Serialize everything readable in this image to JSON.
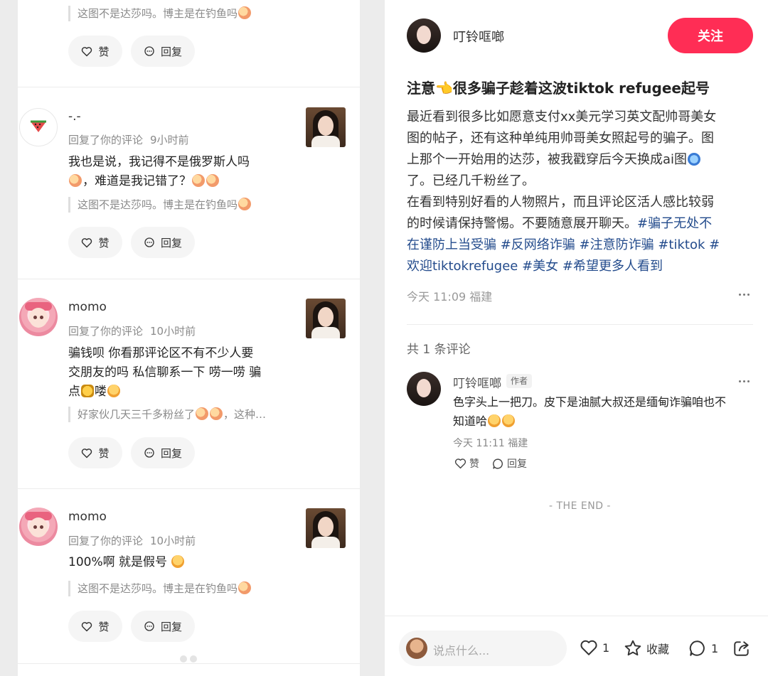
{
  "left_comments": [
    {
      "quote": "这图不是达莎吗。博主是在钓鱼吗",
      "like_label": "赞",
      "reply_label": "回复"
    },
    {
      "username": "-.-",
      "action": "回复了你的评论",
      "time": "9小时前",
      "text_line1": "我也是说，我记得不是俄罗斯人吗",
      "text_line2": "，难道是我记错了？",
      "quote": "这图不是达莎吗。博主是在钓鱼吗",
      "like_label": "赞",
      "reply_label": "回复"
    },
    {
      "username": "momo",
      "action": "回复了你的评论",
      "time": "10小时前",
      "text_line1": "骗钱呗 你看那评论区不有不少人要",
      "text_line2": "交朋友的吗 私信聊系一下 唠一唠 骗",
      "text_line3a": "点",
      "text_line3b": "喽",
      "quote": "好家伙几天三千多粉丝了",
      "quote_tail": "，这种…",
      "like_label": "赞",
      "reply_label": "回复"
    },
    {
      "username": "momo",
      "action": "回复了你的评论",
      "time": "10小时前",
      "text": "100%啊 就是假号",
      "quote": "这图不是达莎吗。博主是在钓鱼吗",
      "like_label": "赞",
      "reply_label": "回复"
    }
  ],
  "post": {
    "author": "叮铃哐啷",
    "follow_label": "关注",
    "title": "注意👈很多骗子趁着这波tiktok refugee起号",
    "body_lines": [
      "最近看到很多比如愿意支付xx美元学习英文配帅哥美女",
      "图的帖子，还有这种单纯用帅哥美女照起号的骗子。图",
      "上那个一开始用的达莎，被我戳穿后今天换成ai图",
      "了。已经几千粉丝了。",
      "在看到特别好看的人物照片，而且评论区活人感比较弱",
      "的时候请保持警惕。不要随意展开聊天。"
    ],
    "tags_line1": "#骗子无处不",
    "tags_line2": "在谨防上当受骗 #反网络诈骗 #注意防诈骗 #tiktok #",
    "tags_line3": "欢迎tiktokrefugee #美女 #希望更多人看到",
    "date": "今天 11:09 福建",
    "comment_count": "共 1 条评论"
  },
  "comment": {
    "author": "叮铃哐啷",
    "badge": "作者",
    "text_line1": "色字头上一把刀。皮下是油腻大叔还是缅甸诈骗咱也不",
    "text_line2": "知道哈",
    "date": "今天 11:11 福建",
    "like_label": "赞",
    "reply_label": "回复"
  },
  "end_text": "- THE END -",
  "bottom_bar": {
    "placeholder": "说点什么...",
    "like_count": "1",
    "collect_label": "收藏",
    "comment_count": "1"
  },
  "icons": [
    "heart-icon",
    "comment-bubble-icon",
    "star-icon",
    "share-icon",
    "more-icon",
    "watermelon-icon"
  ]
}
